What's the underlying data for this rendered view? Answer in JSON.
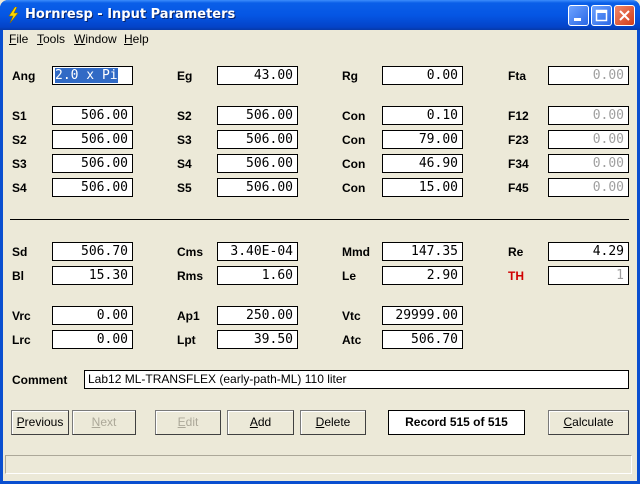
{
  "window": {
    "title": "Hornresp - Input Parameters"
  },
  "menu": [
    {
      "label_u": "F",
      "label_rest": "ile"
    },
    {
      "label_u": "T",
      "label_rest": "ools"
    },
    {
      "label_u": "W",
      "label_rest": "indow"
    },
    {
      "label_u": "H",
      "label_rest": "elp"
    }
  ],
  "params": {
    "Ang": {
      "label": "Ang",
      "value": "2.0 x Pi"
    },
    "Eg": {
      "label": "Eg",
      "value": "43.00"
    },
    "Rg": {
      "label": "Rg",
      "value": "0.00"
    },
    "Fta": {
      "label": "Fta",
      "value": "0.00"
    },
    "S1a": {
      "label": "S1",
      "value": "506.00"
    },
    "S2a": {
      "label": "S2",
      "value": "506.00"
    },
    "Con1": {
      "label": "Con",
      "value": "0.10"
    },
    "F12": {
      "label": "F12",
      "value": "0.00"
    },
    "S2b": {
      "label": "S2",
      "value": "506.00"
    },
    "S3a": {
      "label": "S3",
      "value": "506.00"
    },
    "Con2": {
      "label": "Con",
      "value": "79.00"
    },
    "F23": {
      "label": "F23",
      "value": "0.00"
    },
    "S3b": {
      "label": "S3",
      "value": "506.00"
    },
    "S4a": {
      "label": "S4",
      "value": "506.00"
    },
    "Con3": {
      "label": "Con",
      "value": "46.90"
    },
    "F34": {
      "label": "F34",
      "value": "0.00"
    },
    "S4b": {
      "label": "S4",
      "value": "506.00"
    },
    "S5": {
      "label": "S5",
      "value": "506.00"
    },
    "Con4": {
      "label": "Con",
      "value": "15.00"
    },
    "F45": {
      "label": "F45",
      "value": "0.00"
    },
    "Sd": {
      "label": "Sd",
      "value": "506.70"
    },
    "Cms": {
      "label": "Cms",
      "value": "3.40E-04"
    },
    "Mmd": {
      "label": "Mmd",
      "value": "147.35"
    },
    "Re": {
      "label": "Re",
      "value": "4.29"
    },
    "Bl": {
      "label": "Bl",
      "value": "15.30"
    },
    "Rms": {
      "label": "Rms",
      "value": "1.60"
    },
    "Le": {
      "label": "Le",
      "value": "2.90"
    },
    "TH": {
      "label": "TH",
      "value": "1"
    },
    "Vrc": {
      "label": "Vrc",
      "value": "0.00"
    },
    "Ap1": {
      "label": "Ap1",
      "value": "250.00"
    },
    "Vtc": {
      "label": "Vtc",
      "value": "29999.00"
    },
    "Lrc": {
      "label": "Lrc",
      "value": "0.00"
    },
    "Lpt": {
      "label": "Lpt",
      "value": "39.50"
    },
    "Atc": {
      "label": "Atc",
      "value": "506.70"
    }
  },
  "comment": {
    "label": "Comment",
    "value": "Lab12 ML-TRANSFLEX  (early-path-ML)  110 liter"
  },
  "buttons": {
    "previous": {
      "u": "P",
      "rest": "revious"
    },
    "next": {
      "u": "N",
      "rest": "ext"
    },
    "edit": {
      "u": "E",
      "rest": "dit"
    },
    "add": {
      "u": "A",
      "rest": "dd"
    },
    "delete": {
      "u": "D",
      "rest": "elete"
    },
    "calculate": {
      "u": "C",
      "rest": "alculate"
    }
  },
  "record": "Record 515 of 515",
  "colors": {
    "title_bar": "#0556e4",
    "th_label": "#d00000",
    "selection": "#316ac5"
  }
}
